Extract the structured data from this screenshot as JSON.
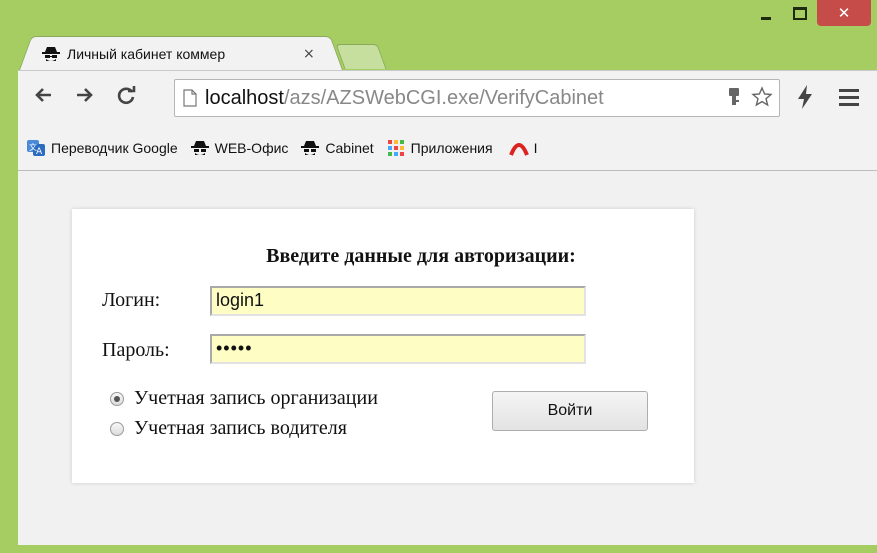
{
  "window": {
    "minimize_label": "_",
    "maximize_label": "□",
    "close_label": "✕"
  },
  "tab": {
    "title": "Личный кабинет коммер",
    "close_label": "×"
  },
  "toolbar": {
    "url_host": "localhost",
    "url_path": "/azs/AZSWebCGI.exe/VerifyCabinet"
  },
  "bookmarks": [
    {
      "label": "Переводчик Google",
      "icon": "translate-icon"
    },
    {
      "label": "WEB-Офис",
      "icon": "spy-icon"
    },
    {
      "label": "Cabinet",
      "icon": "spy-icon"
    },
    {
      "label": "Приложения",
      "icon": "apps-grid-icon"
    },
    {
      "label": "I",
      "icon": "arc-icon"
    }
  ],
  "auth": {
    "title": "Введите данные для авторизации:",
    "login_label": "Логин:",
    "login_value": "login1",
    "password_label": "Пароль:",
    "password_value": "•••••",
    "radio_org": "Учетная запись организации",
    "radio_driver": "Учетная запись водителя",
    "selected": "org",
    "submit_label": "Войти"
  },
  "colors": {
    "frame": "#a6cd62",
    "close": "#c64c4a",
    "input_bg": "#fdfdc4"
  }
}
